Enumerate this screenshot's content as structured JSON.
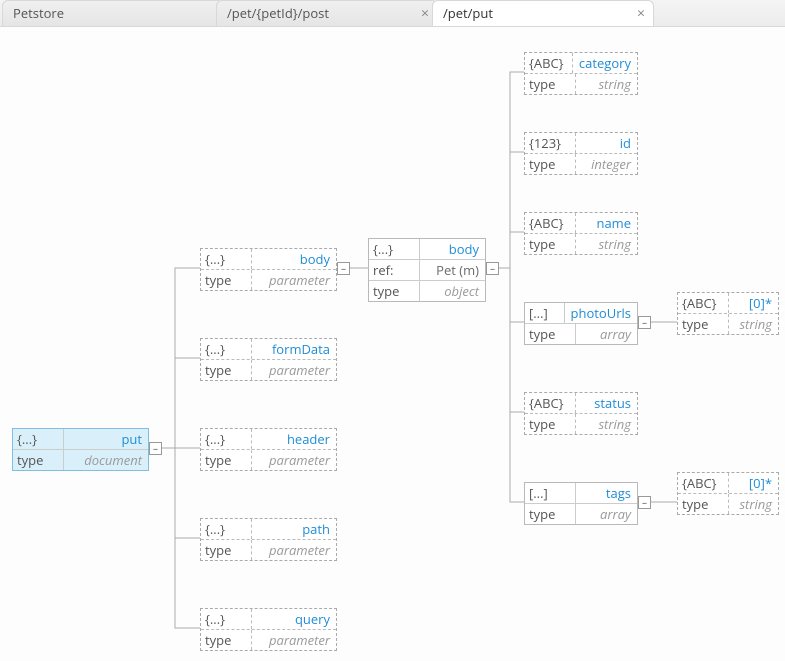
{
  "tabs": {
    "t0": {
      "label": "Petstore"
    },
    "t1": {
      "label": "/pet/{petId}/post",
      "close": "×"
    },
    "t2": {
      "label": "/pet/put",
      "close": "×"
    }
  },
  "root": {
    "icon": "{...}",
    "name": "put",
    "k2": "type",
    "v2": "document"
  },
  "params": {
    "body": {
      "icon": "{...}",
      "name": "body",
      "k2": "type",
      "v2": "parameter"
    },
    "formData": {
      "icon": "{...}",
      "name": "formData",
      "k2": "type",
      "v2": "parameter"
    },
    "header": {
      "icon": "{...}",
      "name": "header",
      "k2": "type",
      "v2": "parameter"
    },
    "path": {
      "icon": "{...}",
      "name": "path",
      "k2": "type",
      "v2": "parameter"
    },
    "query": {
      "icon": "{...}",
      "name": "query",
      "k2": "type",
      "v2": "parameter"
    }
  },
  "bodyObj": {
    "icon": "{...}",
    "name": "body",
    "k2": "ref:",
    "v2": "Pet (m)",
    "k3": "type",
    "v3": "object"
  },
  "props": {
    "category": {
      "icon": "{ABC}",
      "name": "category",
      "k2": "type",
      "v2": "string"
    },
    "id": {
      "icon": "{123}",
      "name": "id",
      "k2": "type",
      "v2": "integer"
    },
    "nameP": {
      "icon": "{ABC}",
      "name": "name",
      "k2": "type",
      "v2": "string"
    },
    "photoUrls": {
      "icon": "[...]",
      "name": "photoUrls",
      "k2": "type",
      "v2": "array"
    },
    "status": {
      "icon": "{ABC}",
      "name": "status",
      "k2": "type",
      "v2": "string"
    },
    "tags": {
      "icon": "[...]",
      "name": "tags",
      "k2": "type",
      "v2": "array"
    }
  },
  "items": {
    "photo": {
      "icon": "{ABC}",
      "name": "[0]*",
      "k2": "type",
      "v2": "string"
    },
    "tag": {
      "icon": "{ABC}",
      "name": "[0]*",
      "k2": "type",
      "v2": "string"
    }
  },
  "expander": "–"
}
